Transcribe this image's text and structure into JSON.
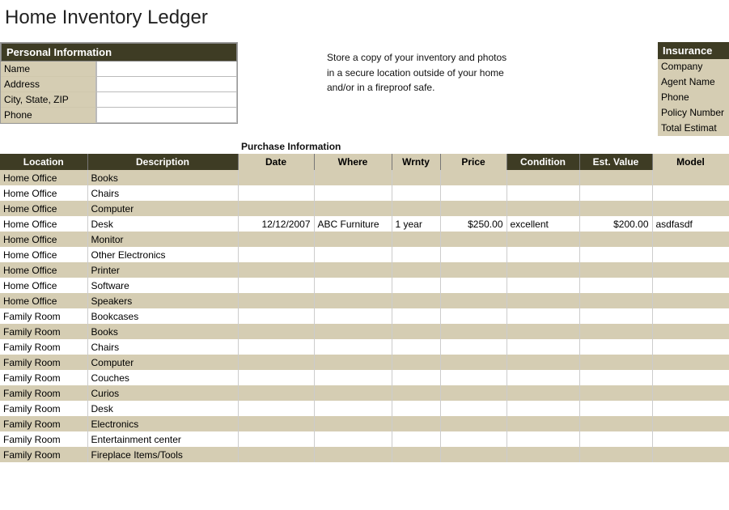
{
  "title": "Home Inventory Ledger",
  "personal": {
    "header": "Personal Information",
    "labels": {
      "name": "Name",
      "address": "Address",
      "csz": "City, State, ZIP",
      "phone": "Phone"
    },
    "values": {
      "name": "",
      "address": "",
      "csz": "",
      "phone": ""
    }
  },
  "note": {
    "line1": "Store a copy of your inventory and photos",
    "line2": "in a secure location outside of your home",
    "line3": "and/or in a fireproof safe."
  },
  "insurance": {
    "header": "Insurance",
    "labels": {
      "company": "Company",
      "agent": "Agent Name",
      "phone": "Phone",
      "policy": "Policy Number",
      "total": "Total Estimat"
    }
  },
  "purchase_caption": "Purchase Information",
  "columns": {
    "location": "Location",
    "description": "Description",
    "date": "Date",
    "where": "Where",
    "wrnty": "Wrnty",
    "price": "Price",
    "condition": "Condition",
    "estvalue": "Est. Value",
    "model": "Model"
  },
  "rows": [
    {
      "location": "Home Office",
      "description": "Books",
      "date": "",
      "where": "",
      "wrnty": "",
      "price": "",
      "condition": "",
      "estvalue": "",
      "model": ""
    },
    {
      "location": "Home Office",
      "description": "Chairs",
      "date": "",
      "where": "",
      "wrnty": "",
      "price": "",
      "condition": "",
      "estvalue": "",
      "model": ""
    },
    {
      "location": "Home Office",
      "description": "Computer",
      "date": "",
      "where": "",
      "wrnty": "",
      "price": "",
      "condition": "",
      "estvalue": "",
      "model": ""
    },
    {
      "location": "Home Office",
      "description": "Desk",
      "date": "12/12/2007",
      "where": "ABC Furniture",
      "wrnty": "1 year",
      "price": "$250.00",
      "condition": "excellent",
      "estvalue": "$200.00",
      "model": "asdfasdf"
    },
    {
      "location": "Home Office",
      "description": "Monitor",
      "date": "",
      "where": "",
      "wrnty": "",
      "price": "",
      "condition": "",
      "estvalue": "",
      "model": ""
    },
    {
      "location": "Home Office",
      "description": "Other Electronics",
      "date": "",
      "where": "",
      "wrnty": "",
      "price": "",
      "condition": "",
      "estvalue": "",
      "model": ""
    },
    {
      "location": "Home Office",
      "description": "Printer",
      "date": "",
      "where": "",
      "wrnty": "",
      "price": "",
      "condition": "",
      "estvalue": "",
      "model": ""
    },
    {
      "location": "Home Office",
      "description": "Software",
      "date": "",
      "where": "",
      "wrnty": "",
      "price": "",
      "condition": "",
      "estvalue": "",
      "model": ""
    },
    {
      "location": "Home Office",
      "description": "Speakers",
      "date": "",
      "where": "",
      "wrnty": "",
      "price": "",
      "condition": "",
      "estvalue": "",
      "model": ""
    },
    {
      "location": "Family Room",
      "description": "Bookcases",
      "date": "",
      "where": "",
      "wrnty": "",
      "price": "",
      "condition": "",
      "estvalue": "",
      "model": ""
    },
    {
      "location": "Family Room",
      "description": "Books",
      "date": "",
      "where": "",
      "wrnty": "",
      "price": "",
      "condition": "",
      "estvalue": "",
      "model": ""
    },
    {
      "location": "Family Room",
      "description": "Chairs",
      "date": "",
      "where": "",
      "wrnty": "",
      "price": "",
      "condition": "",
      "estvalue": "",
      "model": ""
    },
    {
      "location": "Family Room",
      "description": "Computer",
      "date": "",
      "where": "",
      "wrnty": "",
      "price": "",
      "condition": "",
      "estvalue": "",
      "model": ""
    },
    {
      "location": "Family Room",
      "description": "Couches",
      "date": "",
      "where": "",
      "wrnty": "",
      "price": "",
      "condition": "",
      "estvalue": "",
      "model": ""
    },
    {
      "location": "Family Room",
      "description": "Curios",
      "date": "",
      "where": "",
      "wrnty": "",
      "price": "",
      "condition": "",
      "estvalue": "",
      "model": ""
    },
    {
      "location": "Family Room",
      "description": "Desk",
      "date": "",
      "where": "",
      "wrnty": "",
      "price": "",
      "condition": "",
      "estvalue": "",
      "model": ""
    },
    {
      "location": "Family Room",
      "description": "Electronics",
      "date": "",
      "where": "",
      "wrnty": "",
      "price": "",
      "condition": "",
      "estvalue": "",
      "model": ""
    },
    {
      "location": "Family Room",
      "description": "Entertainment center",
      "date": "",
      "where": "",
      "wrnty": "",
      "price": "",
      "condition": "",
      "estvalue": "",
      "model": ""
    },
    {
      "location": "Family Room",
      "description": "Fireplace Items/Tools",
      "date": "",
      "where": "",
      "wrnty": "",
      "price": "",
      "condition": "",
      "estvalue": "",
      "model": ""
    }
  ]
}
